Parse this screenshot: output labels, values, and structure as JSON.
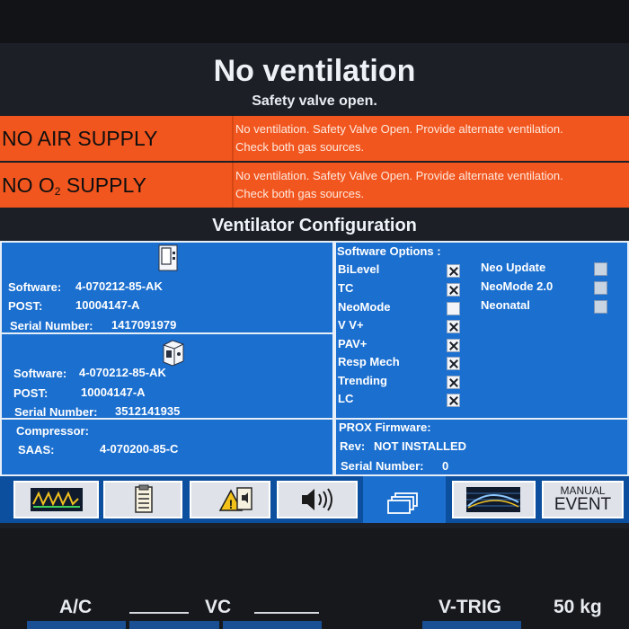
{
  "banner": {
    "title": "No ventilation",
    "subtitle": "Safety valve open."
  },
  "alarms": [
    {
      "name": "NO AIR SUPPLY",
      "line1": "No ventilation. Safety Valve Open.  Provide alternate ventilation.",
      "line2": "Check both gas sources."
    },
    {
      "name_prefix": "NO O",
      "name_sub": "2",
      "name_suffix": " SUPPLY",
      "line1": "No ventilation. Safety Valve Open.  Provide alternate ventilation.",
      "line2": "Check both gas sources."
    }
  ],
  "config": {
    "title": "Ventilator Configuration",
    "gui": {
      "icon": "monitor-icon",
      "software_label": "Software:",
      "software_value": "4-070212-85-AK",
      "post_label": "POST:",
      "post_value": "10004147-A",
      "serial_label": "Serial Number:",
      "serial_value": "1417091979"
    },
    "bdu": {
      "icon": "ventilator-unit-icon",
      "software_label": "Software:",
      "software_value": "4-070212-85-AK",
      "post_label": "POST:",
      "post_value": "10004147-A",
      "serial_label": "Serial Number:",
      "serial_value": "3512141935"
    },
    "compressor": {
      "label": "Compressor:",
      "saas_label": "SAAS:",
      "saas_value": "4-070200-85-C"
    },
    "software_options": {
      "title": "Software Options :",
      "left": [
        {
          "label": "BiLevel",
          "checked": true
        },
        {
          "label": "TC",
          "checked": true
        },
        {
          "label": "NeoMode",
          "checked": false
        },
        {
          "label": "V V+",
          "checked": true
        },
        {
          "label": "PAV+",
          "checked": true
        },
        {
          "label": "Resp Mech",
          "checked": true
        },
        {
          "label": "Trending",
          "checked": true
        },
        {
          "label": "LC",
          "checked": true
        }
      ],
      "right": [
        {
          "label": "Neo Update",
          "checked": false
        },
        {
          "label": "NeoMode 2.0",
          "checked": false
        },
        {
          "label": "Neonatal",
          "checked": false
        }
      ]
    },
    "prox": {
      "title": "PROX Firmware:",
      "rev_label": "Rev:",
      "rev_value": "NOT INSTALLED",
      "serial_label": "Serial Number:",
      "serial_value": "0"
    }
  },
  "tabs": [
    {
      "name": "waveform-icon"
    },
    {
      "name": "clipboard-icon"
    },
    {
      "name": "alarm-settings-icon"
    },
    {
      "name": "volume-icon"
    },
    {
      "name": "configuration-screens-icon",
      "active": true
    },
    {
      "name": "trend-graph-icon"
    },
    {
      "name": "manual-event",
      "line1": "MANUAL",
      "line2": "EVENT"
    }
  ],
  "status": {
    "mode": "A/C",
    "mandatory_type": "VC",
    "trigger": "V-TRIG",
    "weight": "50 kg"
  },
  "colors": {
    "alarm": "#f2561f",
    "panel": "#1b6fcf",
    "tab_bar": "#0c4f9e",
    "screen_bg": "#1c2026"
  }
}
